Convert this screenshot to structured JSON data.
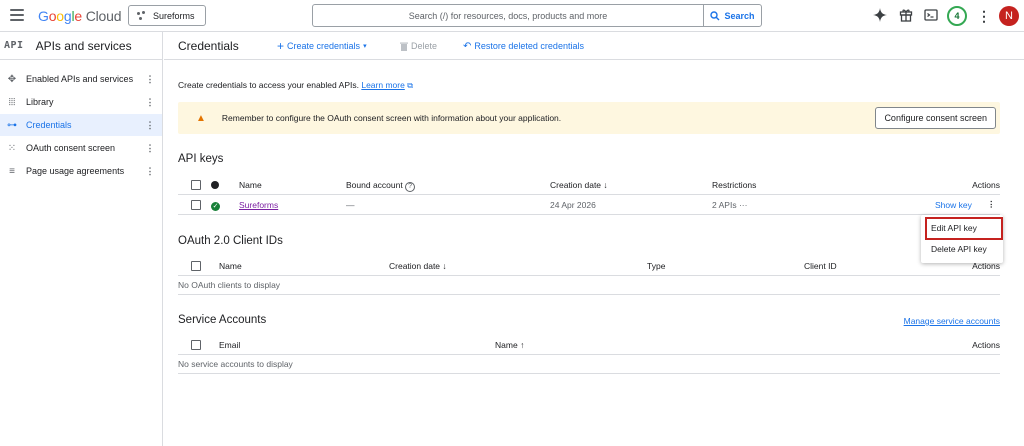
{
  "topbar": {
    "brand_google": [
      "G",
      "o",
      "o",
      "g",
      "l",
      "e"
    ],
    "brand_cloud": "Cloud",
    "project": "Sureforms",
    "search_placeholder": "Search (/) for resources, docs, products and more",
    "search_button": "Search",
    "notifications_count": "4",
    "avatar_initial": "N"
  },
  "sidebar": {
    "badge": "API",
    "title": "APIs and services",
    "items": [
      {
        "label": "Enabled APIs and services",
        "icon": "hub-icon"
      },
      {
        "label": "Library",
        "icon": "library-icon"
      },
      {
        "label": "Credentials",
        "icon": "key-icon"
      },
      {
        "label": "OAuth consent screen",
        "icon": "consent-icon"
      },
      {
        "label": "Page usage agreements",
        "icon": "agreements-icon"
      }
    ]
  },
  "header": {
    "title": "Credentials",
    "create": "Create credentials",
    "delete": "Delete",
    "restore": "Restore deleted credentials"
  },
  "intro": {
    "text": "Create credentials to access your enabled APIs.",
    "learn_more": "Learn more"
  },
  "banner": {
    "message": "Remember to configure the OAuth consent screen with information about your application.",
    "button": "Configure consent screen"
  },
  "api_keys": {
    "title": "API keys",
    "headers": {
      "name": "Name",
      "bound": "Bound account",
      "created": "Creation date",
      "restrictions": "Restrictions",
      "actions": "Actions"
    },
    "rows": [
      {
        "name": "Sureforms",
        "bound": "—",
        "created": "24 Apr 2026",
        "restrictions": "2 APIs",
        "more": "···",
        "action": "Show key"
      }
    ]
  },
  "oauth": {
    "title": "OAuth 2.0 Client IDs",
    "headers": {
      "name": "Name",
      "created": "Creation date",
      "type": "Type",
      "client_id": "Client ID",
      "actions": "Actions"
    },
    "empty": "No OAuth clients to display"
  },
  "service_accounts": {
    "title": "Service Accounts",
    "manage": "Manage service accounts",
    "headers": {
      "email": "Email",
      "name": "Name",
      "actions": "Actions"
    },
    "empty": "No service accounts to display"
  },
  "menu": {
    "edit": "Edit API key",
    "delete": "Delete API key"
  },
  "colors": {
    "accent": "#1a73e8",
    "highlight": "#c5221f",
    "banner_bg": "#fef7e0",
    "active_bg": "#e8f0fe"
  }
}
